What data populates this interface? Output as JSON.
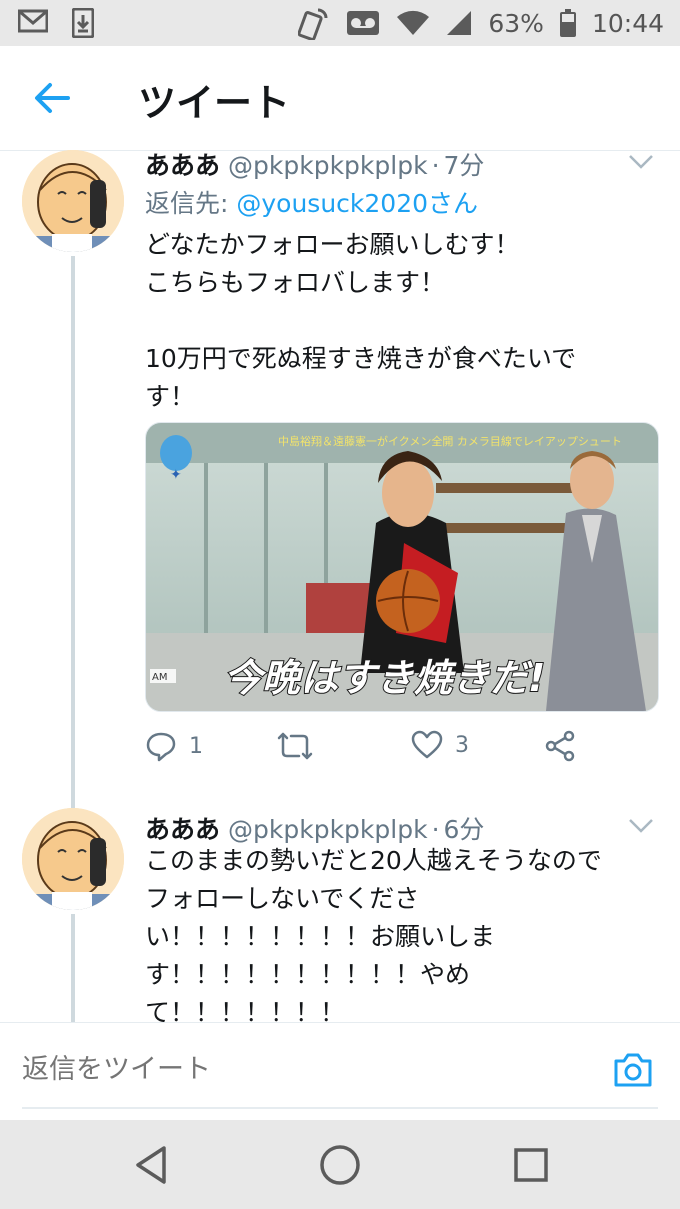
{
  "status_bar": {
    "battery": "63%",
    "time": "10:44",
    "icons": [
      "mail-icon",
      "download-icon",
      "nfc-icon",
      "voicemail-icon",
      "wifi-icon",
      "signal-icon",
      "battery-icon"
    ]
  },
  "header": {
    "title": "ツイート",
    "back_icon": "back-arrow-icon"
  },
  "tweets": [
    {
      "name": "あああ",
      "handle": "@pkpkpkpkplpk",
      "dot": "·",
      "time": "7分",
      "reply_prefix": "返信先: ",
      "reply_to": "@yousuck2020さん",
      "lines": [
        "どなたかフォローお願いしむす！",
        "こちらもフォロバします！",
        "",
        "10万円で死ぬ程すき焼きが食べたいで",
        "す！"
      ],
      "media": {
        "caption": "今晩はすき焼きだ!",
        "banner": "中島裕翔＆遠藤憲一がイクメン全開 カメラ目線でレイアップシュート",
        "corner_label": "AM"
      },
      "actions": {
        "reply_count": "1",
        "retweet_count": "",
        "like_count": "3"
      }
    },
    {
      "name": "あああ",
      "handle": "@pkpkpkpkplpk",
      "dot": "·",
      "time": "6分",
      "lines": [
        "このままの勢いだと20人越えそうなので",
        "フォローしないでくださ",
        "い！！！！！！！！お願いしま",
        "す！！！！！！！！！！やめ",
        "て！！！！！！！"
      ]
    }
  ],
  "composer": {
    "placeholder": "返信をツイート"
  },
  "colors": {
    "accent": "#1da1f2",
    "secondary_text": "#657786",
    "status_bar_bg": "#e8e8e8"
  }
}
